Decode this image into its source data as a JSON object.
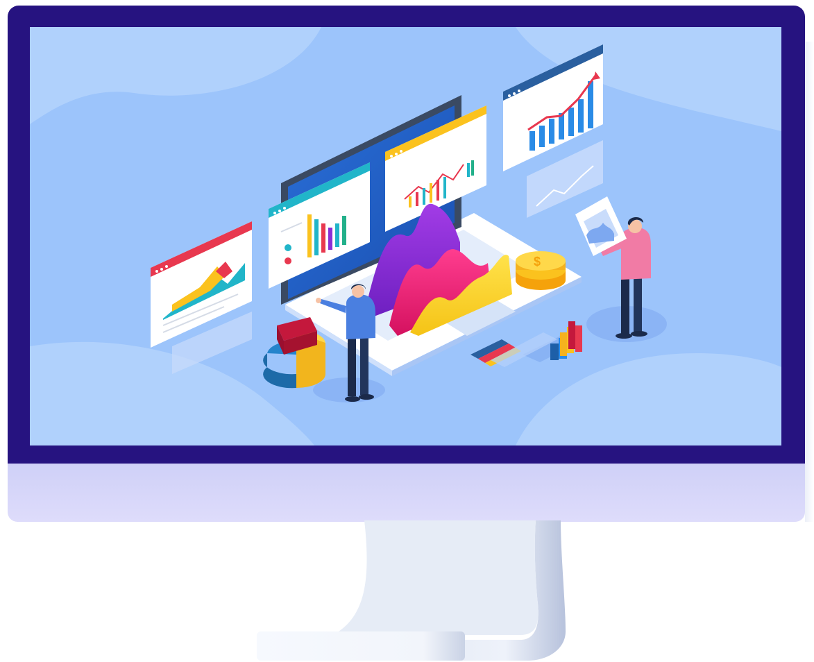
{
  "colors": {
    "bezel": "#261380",
    "chin": "#d6d5f9",
    "screen_bg": "#9cc4fb",
    "accent_red": "#e8384f",
    "accent_yellow": "#fbc21e",
    "accent_teal": "#21b5c9",
    "accent_purple": "#8a2fd6",
    "accent_pink": "#f0257a"
  },
  "illustration": {
    "icons": [
      "monitor-frame",
      "laptop",
      "dashboard-windows",
      "3d-wave-chart",
      "pie-chart-3d",
      "coin-stack",
      "bar-chart-3d",
      "person-pointing",
      "person-reading-report"
    ]
  }
}
